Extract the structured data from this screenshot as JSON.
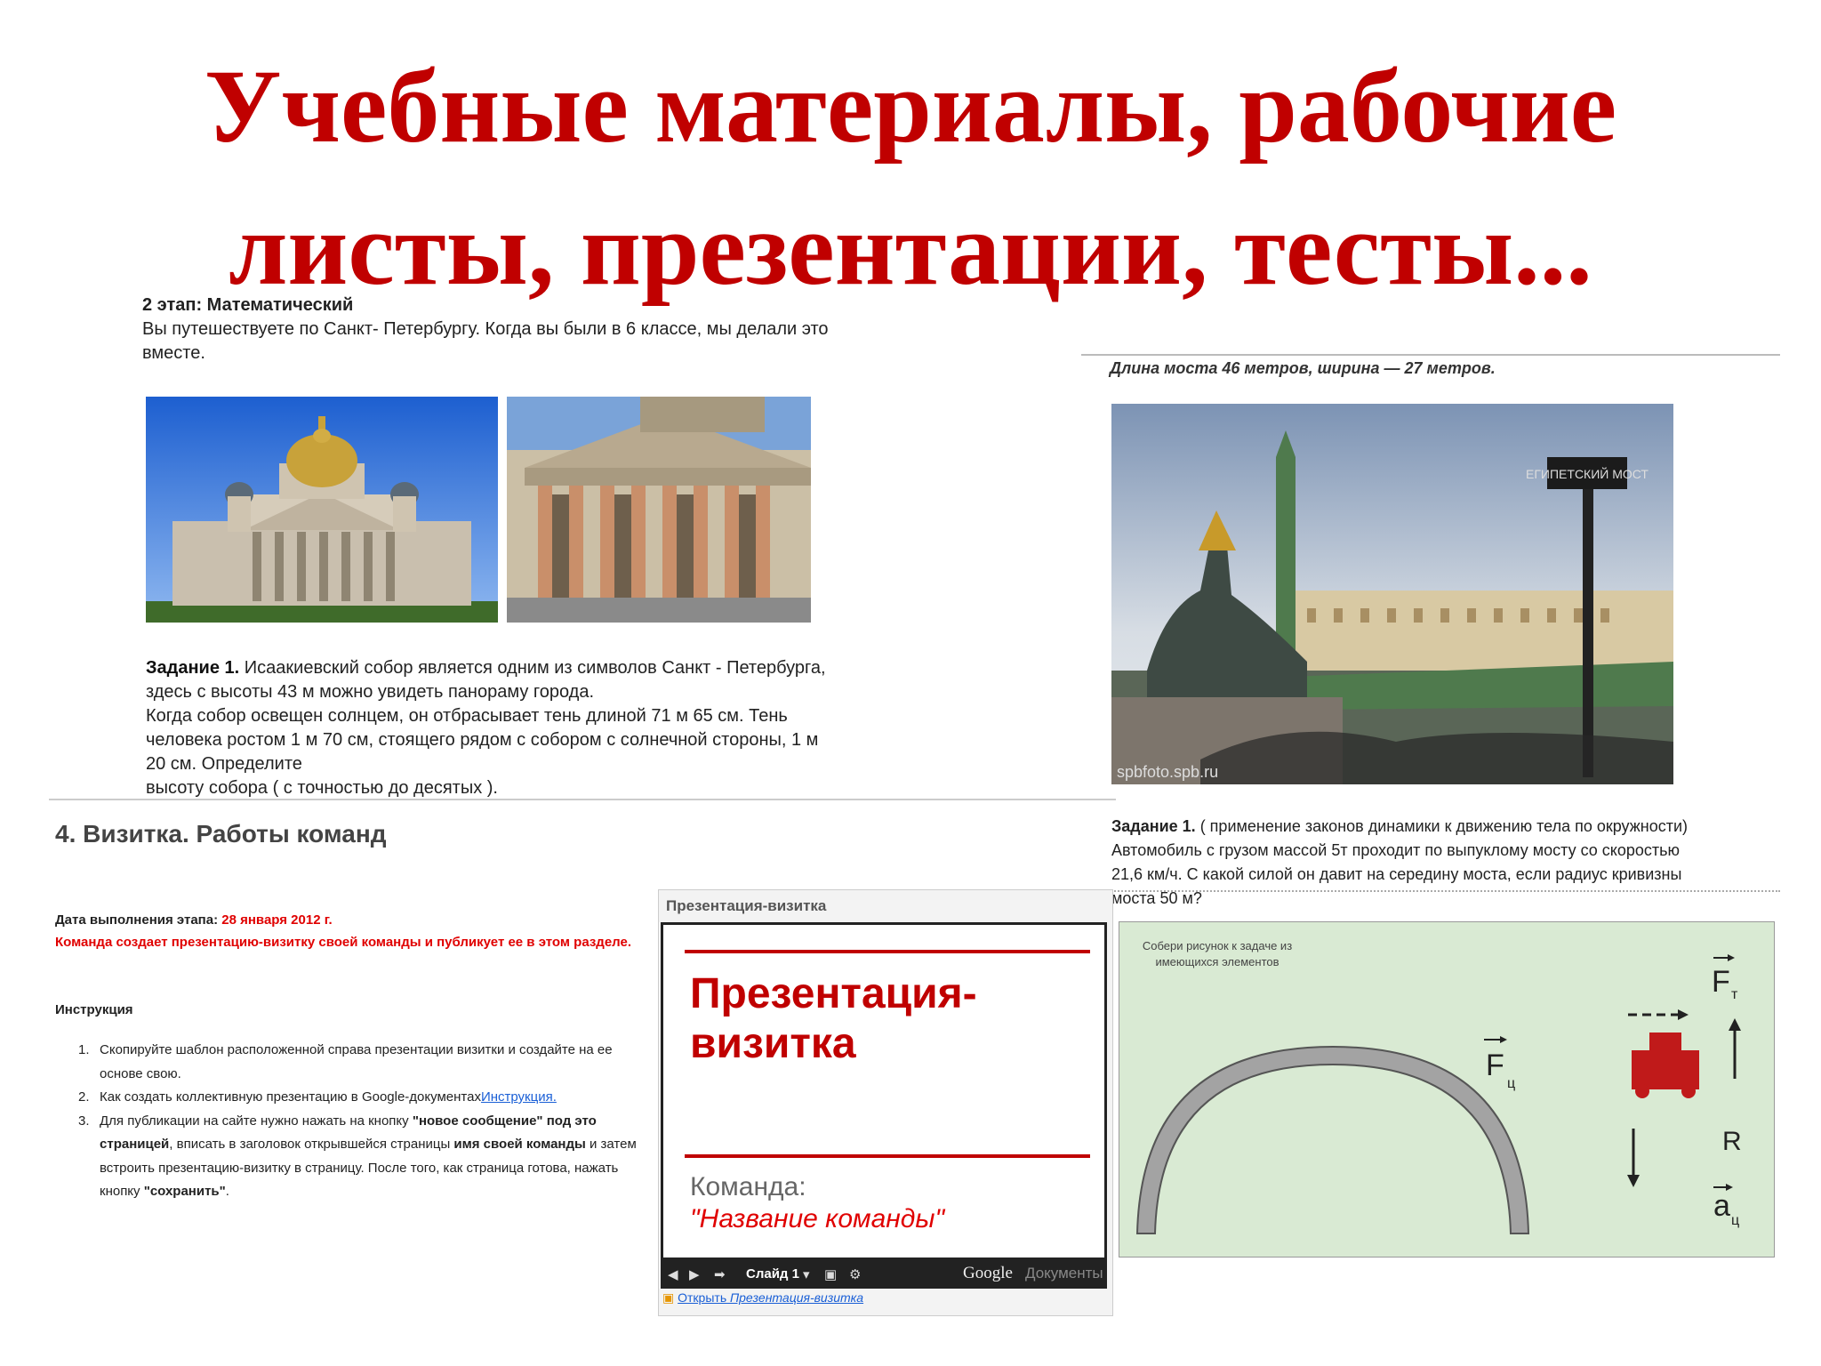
{
  "slide": {
    "title_line1": "Учебные материалы, рабочие",
    "title_line2": "листы, презентации, тесты..."
  },
  "panel1": {
    "stage": "2 этап: Математический",
    "intro_line1": "Вы путешествуете по Санкт- Петербургу. Когда вы были в 6 классе, мы делали это",
    "intro_line2": "вместе.",
    "task_label": "Задание 1.",
    "task_line1": " Исаакиевский собор является одним из символов Санкт - Петербурга,",
    "task_line2": "здесь с высоты 43 м можно увидеть панораму города.",
    "task_line3": "Когда собор освещен солнцем, он отбрасывает тень длиной 71 м 65 см. Тень",
    "task_line4": "человека ростом 1 м 70 см, стоящего рядом с собором с солнечной стороны, 1 м",
    "task_line5": "20 см. Определите",
    "task_line6": "высоту собора ( с точностью до десятых )."
  },
  "panel2": {
    "caption": "Длина моста 46 метров, ширина — 27 метров.",
    "sign_text": "ЕГИПЕТСКИЙ МОСТ",
    "watermark": "spbfoto.spb.ru",
    "task_label": "Задание 1.",
    "task_line1": " ( применение законов динамики к движению тела по окружности)",
    "task_line2": "Автомобиль с грузом массой 5т проходит по выпуклому мосту со скоростью",
    "task_line3": "21,6 км/ч.      С какой силой он давит на середину моста, если радиус кривизны",
    "task_line4": "моста 50 м?",
    "diagram_hint": "Собери рисунок к задаче из имеющихся элементов",
    "label_ft": "F",
    "label_ft_sub": "т",
    "label_fc": "F",
    "label_fc_sub": "ц",
    "label_r": "R",
    "label_a": "a",
    "label_a_sub": "ц"
  },
  "panel3": {
    "heading": "4. Визитка. Работы команд",
    "date_label": "Дата выполнения этапа: ",
    "date_value": "28 января 2012 г.",
    "description": "Команда создает презентацию-визитку своей команды и публикует ее в этом разделе.",
    "instructions_label": "Инструкция",
    "items": [
      {
        "num": "1.",
        "text": "Скопируйте шаблон расположенной справа презентации визитки и создайте на ее основе свою."
      },
      {
        "num": "2.",
        "text": "Как создать коллективную презентацию в Google-документах",
        "link": "Инструкция."
      },
      {
        "num": "3.",
        "pre": "Для публикации на сайте нужно нажать на кнопку ",
        "b1": "\"новое сообщение\" под это страницей",
        "mid": ", вписать в заголовок открывшейся страницы ",
        "b2": "имя своей команды",
        "mid2": " и затем встроить презентацию-визитку в страницу. После того, как страница готова, нажать кнопку ",
        "b3": "\"сохранить\"",
        "end": "."
      }
    ]
  },
  "embed": {
    "header": "Презентация-визитка",
    "slide_title_line1": "Презентация-",
    "slide_title_line2": "визитка",
    "team_label": "Команда:",
    "team_name": "\"Название команды\"",
    "slide_selector": "Слайд 1",
    "brand": "Google",
    "brand_suffix": "Документы",
    "open_label": "Открыть ",
    "open_link": "Презентация-визитка"
  },
  "colors": {
    "title_red": "#c00000",
    "accent_red": "#e00000",
    "link_blue": "#1a5fd6",
    "diagram_bg": "#d9ead3"
  }
}
